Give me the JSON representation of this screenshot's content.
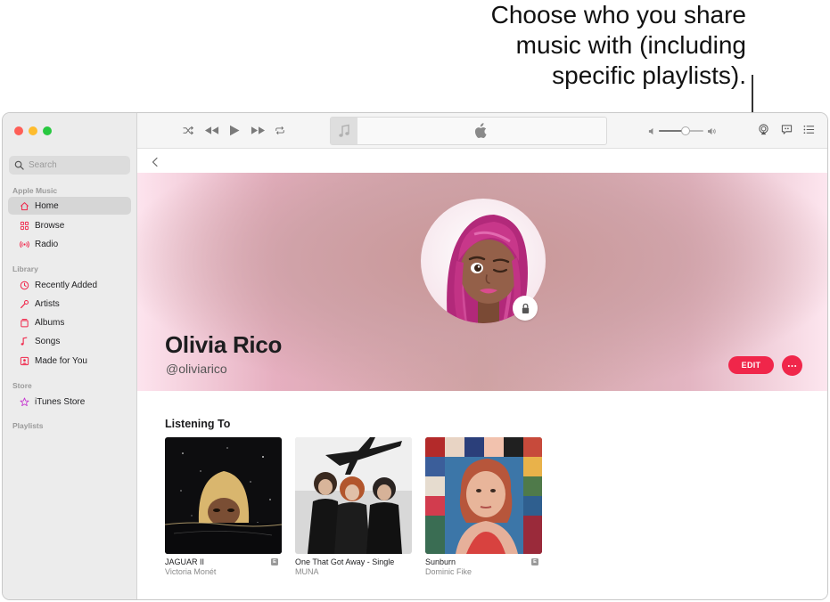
{
  "callout": {
    "line1": "Choose who you share",
    "line2": "music with (including",
    "line3": "specific playlists)."
  },
  "sidebar": {
    "search_placeholder": "Search",
    "sections": {
      "apple_music": "Apple Music",
      "library": "Library",
      "store": "Store",
      "playlists": "Playlists"
    },
    "items": {
      "home": "Home",
      "browse": "Browse",
      "radio": "Radio",
      "recently_added": "Recently Added",
      "artists": "Artists",
      "albums": "Albums",
      "songs": "Songs",
      "made_for_you": "Made for You",
      "itunes_store": "iTunes Store"
    },
    "active_item": "Home"
  },
  "player": {
    "volume_level": 0.6
  },
  "profile": {
    "name": "Olivia Rico",
    "handle": "@oliviarico",
    "edit_label": "EDIT"
  },
  "listening": {
    "title": "Listening To",
    "albums": [
      {
        "title": "JAGUAR II",
        "artist": "Victoria Monét",
        "explicit": true
      },
      {
        "title": "One That Got Away - Single",
        "artist": "MUNA",
        "explicit": false
      },
      {
        "title": "Sunburn",
        "artist": "Dominic Fike",
        "explicit": true
      }
    ],
    "explicit_badge": "E"
  },
  "colors": {
    "accent": "#f0264a",
    "sidebar_bg": "#ececec"
  },
  "icons": {
    "back": "chevron-left-icon",
    "lock": "lock-icon",
    "more": "ellipsis-icon"
  }
}
